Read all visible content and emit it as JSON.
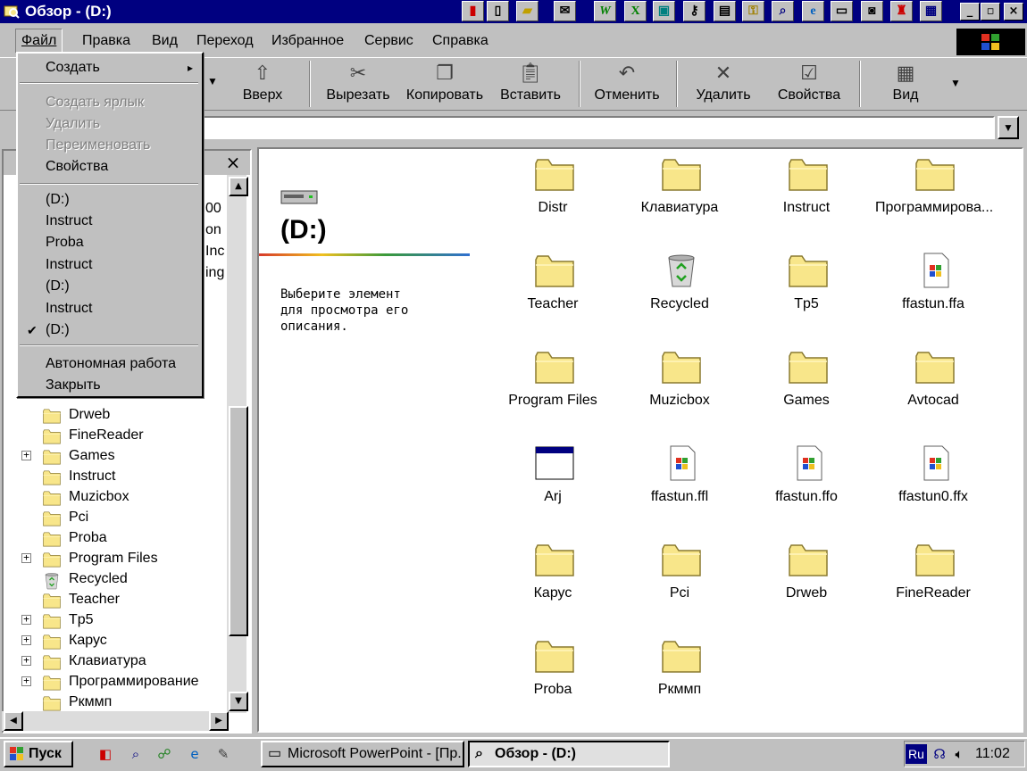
{
  "window": {
    "title": "Обзор -  (D:)",
    "caption_buttons": [
      "_",
      "▫",
      "×"
    ]
  },
  "menubar": {
    "items": [
      "Файл",
      "Правка",
      "Вид",
      "Переход",
      "Избранное",
      "Сервис",
      "Справка"
    ]
  },
  "file_menu": {
    "items": [
      {
        "label": "Создать",
        "submenu": "▸"
      },
      {
        "label": "Создать ярлык"
      },
      {
        "label": "Удалить"
      },
      {
        "label": "Переименовать"
      },
      {
        "label": "Свойства"
      },
      {
        "label": "(D:)"
      },
      {
        "label": "Instruct"
      },
      {
        "label": "Proba"
      },
      {
        "label": "Instruct"
      },
      {
        "label": "(D:)"
      },
      {
        "label": "Instruct"
      },
      {
        "label": "(D:)",
        "check": "✔"
      },
      {
        "label": "Автономная работа"
      },
      {
        "label": "Закрыть"
      }
    ]
  },
  "toolbar": {
    "buttons": [
      {
        "label": "Вверх",
        "icon": "up-folder-icon"
      },
      {
        "label": "Вырезать",
        "icon": "scissors-icon"
      },
      {
        "label": "Копировать",
        "icon": "copy-icon"
      },
      {
        "label": "Вставить",
        "icon": "paste-icon"
      },
      {
        "label": "Отменить",
        "icon": "undo-icon"
      },
      {
        "label": "Удалить",
        "icon": "delete-x-icon"
      },
      {
        "label": "Свойства",
        "icon": "properties-icon"
      },
      {
        "label": "Вид",
        "icon": "view-icon"
      }
    ]
  },
  "left_pane": {
    "close": "×",
    "hidden_fragments": [
      "00",
      "on",
      "Inc",
      "ing"
    ],
    "tree": [
      {
        "label": "Drweb",
        "expand": ""
      },
      {
        "label": "FineReader",
        "expand": ""
      },
      {
        "label": "Games",
        "expand": "+"
      },
      {
        "label": "Instruct",
        "expand": ""
      },
      {
        "label": "Muzicbox",
        "expand": ""
      },
      {
        "label": "Pci",
        "expand": ""
      },
      {
        "label": "Proba",
        "expand": ""
      },
      {
        "label": "Program Files",
        "expand": "+"
      },
      {
        "label": "Recycled",
        "expand": "",
        "icon": "recycle"
      },
      {
        "label": "Teacher",
        "expand": ""
      },
      {
        "label": "Tp5",
        "expand": "+"
      },
      {
        "label": "Карус",
        "expand": "+"
      },
      {
        "label": "Клавиатура",
        "expand": "+"
      },
      {
        "label": "Программирование",
        "expand": "+"
      },
      {
        "label": "Ркммп",
        "expand": ""
      }
    ]
  },
  "right_pane": {
    "drive_title": "(D:)",
    "description": "Выберите элемент\nдля просмотра его\nописания.",
    "files": [
      {
        "label": "Distr",
        "icon": "folder"
      },
      {
        "label": "Клавиатура",
        "icon": "folder"
      },
      {
        "label": "Instruct",
        "icon": "folder"
      },
      {
        "label": "Программирова...",
        "icon": "folder"
      },
      {
        "label": "Teacher",
        "icon": "folder"
      },
      {
        "label": "Recycled",
        "icon": "recycle"
      },
      {
        "label": "Tp5",
        "icon": "folder"
      },
      {
        "label": "ffastun.ffa",
        "icon": "doc"
      },
      {
        "label": "Program Files",
        "icon": "folder"
      },
      {
        "label": "Muzicbox",
        "icon": "folder"
      },
      {
        "label": "Games",
        "icon": "folder"
      },
      {
        "label": "Avtocad",
        "icon": "folder"
      },
      {
        "label": "Arj",
        "icon": "window"
      },
      {
        "label": "ffastun.ffl",
        "icon": "doc"
      },
      {
        "label": "ffastun.ffo",
        "icon": "doc"
      },
      {
        "label": "ffastun0.ffx",
        "icon": "doc"
      },
      {
        "label": "Карус",
        "icon": "folder"
      },
      {
        "label": "Pci",
        "icon": "folder"
      },
      {
        "label": "Drweb",
        "icon": "folder"
      },
      {
        "label": "FineReader",
        "icon": "folder"
      },
      {
        "label": "Proba",
        "icon": "folder"
      },
      {
        "label": "Ркммп",
        "icon": "folder"
      }
    ]
  },
  "taskbar": {
    "start": "Пуск",
    "tasks": [
      "Microsoft PowerPoint - [Пр...",
      "Обзор -  (D:)"
    ],
    "language": "Ru",
    "clock": "11:02"
  },
  "colors": {
    "titlebar": "#000080",
    "folder": "#f8e68a",
    "face": "#c0c0c0"
  }
}
